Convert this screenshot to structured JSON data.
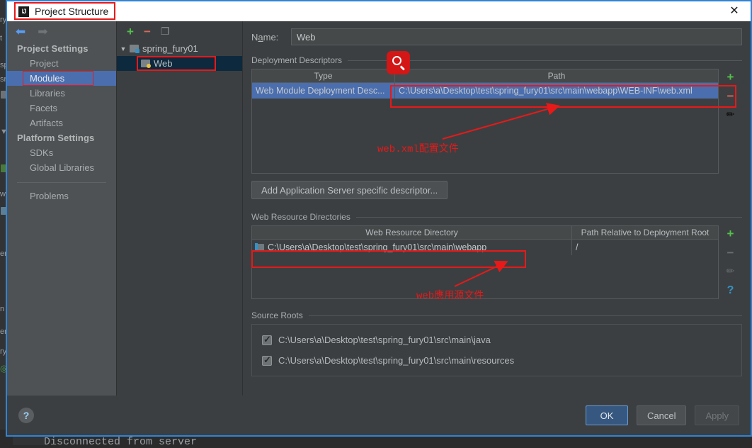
{
  "background": {
    "console_text": "Disconnected from server",
    "left_fragments": [
      "ry",
      "t",
      "sp",
      "sr",
      "w",
      "er",
      "n",
      "er",
      "ry"
    ]
  },
  "dialog": {
    "title": "Project Structure",
    "app_icon": "IJ",
    "close_icon": "close-icon"
  },
  "sidebar": {
    "back_icon": "◄",
    "forward_icon": "►",
    "groups": [
      {
        "label": "Project Settings",
        "items": [
          {
            "label": "Project",
            "selected": false
          },
          {
            "label": "Modules",
            "selected": true
          },
          {
            "label": "Libraries",
            "selected": false
          },
          {
            "label": "Facets",
            "selected": false
          },
          {
            "label": "Artifacts",
            "selected": false
          }
        ]
      },
      {
        "label": "Platform Settings",
        "items": [
          {
            "label": "SDKs",
            "selected": false
          },
          {
            "label": "Global Libraries",
            "selected": false
          }
        ]
      }
    ],
    "problems_label": "Problems"
  },
  "tree": {
    "toolbar": {
      "add_icon": "+",
      "remove_icon": "−",
      "copy_icon": "copy-icon"
    },
    "root": {
      "label": "spring_fury01",
      "expanded": true,
      "twisty": "▼"
    },
    "child": {
      "label": "Web",
      "selected": true
    }
  },
  "main": {
    "name_label_pre": "N",
    "name_label_mnemonic": "a",
    "name_label_post": "me:",
    "name_value": "Web",
    "deployment_descriptors": {
      "legend": "Deployment Descriptors",
      "columns": [
        "Type",
        "Path"
      ],
      "rows": [
        {
          "type": "Web Module Deployment Desc...",
          "path": "C:\\Users\\a\\Desktop\\test\\spring_fury01\\src\\main\\webapp\\WEB-INF\\web.xml",
          "selected": true
        }
      ],
      "tools": [
        "+",
        "−",
        "pencil-icon"
      ]
    },
    "add_descriptor_button": "Add Application Server specific descriptor...",
    "web_resource_directories": {
      "legend": "Web Resource Directories",
      "columns": [
        "Web Resource Directory",
        "Path Relative to Deployment Root"
      ],
      "rows": [
        {
          "directory": "C:\\Users\\a\\Desktop\\test\\spring_fury01\\src\\main\\webapp",
          "relative": "/"
        }
      ],
      "tools": [
        "+",
        "−",
        "pencil-icon",
        "?"
      ]
    },
    "source_roots": {
      "legend": "Source Roots",
      "items": [
        {
          "path": "C:\\Users\\a\\Desktop\\test\\spring_fury01\\src\\main\\java",
          "checked": true
        },
        {
          "path": "C:\\Users\\a\\Desktop\\test\\spring_fury01\\src\\main\\resources",
          "checked": true
        }
      ]
    }
  },
  "footer": {
    "help_icon": "?",
    "ok_label": "OK",
    "cancel_label": "Cancel",
    "apply_label": "Apply"
  },
  "annotations": {
    "magnifier_icon": "search-icon",
    "note_webxml": "web.xml配置文件",
    "note_websrc": "web應用源文件",
    "color": "#e81919"
  }
}
